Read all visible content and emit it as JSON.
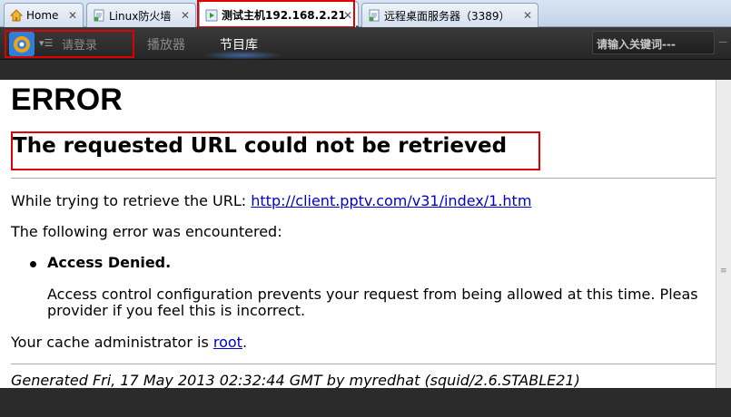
{
  "tabs": [
    {
      "label": "Home",
      "icon": "home-icon"
    },
    {
      "label": "Linux防火墙",
      "icon": "document-icon"
    },
    {
      "label": "测试主机192.168.2.21",
      "icon": "play-icon",
      "active": true
    },
    {
      "label": "远程桌面服务器（3389）",
      "icon": "document-icon"
    }
  ],
  "player": {
    "login": "请登录",
    "nav_player": "播放器",
    "nav_library": "节目库",
    "search_placeholder": "请输入关键词---"
  },
  "page": {
    "title": "ERROR",
    "subtitle": "The requested URL could not be retrieved",
    "trying_prefix": "While trying to retrieve the URL: ",
    "url": "http://client.pptv.com/v31/index/1.htm",
    "encountered": "The following error was encountered:",
    "bullet": "Access Denied.",
    "desc_line1": "Access control configuration prevents your request from being allowed at this time. Pleas",
    "desc_line2": "provider if you feel this is incorrect.",
    "admin_prefix": "Your cache administrator is ",
    "admin_link": "root",
    "admin_suffix": ".",
    "generated": "Generated Fri, 17 May 2013 02:32:44 GMT by myredhat (squid/2.6.STABLE21)"
  },
  "colors": {
    "highlight": "#e00000",
    "link": "#0000cc",
    "player_bg": "#2b2b2b"
  }
}
